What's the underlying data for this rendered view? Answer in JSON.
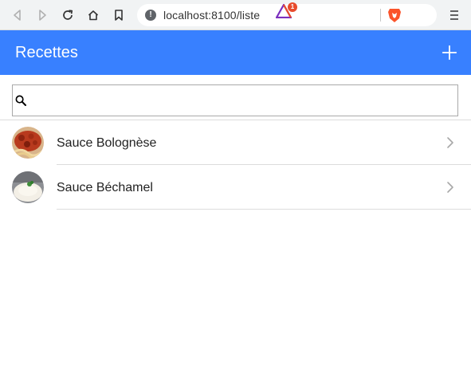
{
  "browser": {
    "url": "localhost:8100/liste",
    "rewards_badge": "1"
  },
  "header": {
    "title": "Recettes"
  },
  "search": {
    "value": "",
    "placeholder": ""
  },
  "recipes": [
    {
      "label": "Sauce Bolognèse"
    },
    {
      "label": "Sauce Béchamel"
    }
  ],
  "colors": {
    "toolbar": "#3880ff",
    "divider": "#dcdcdc"
  }
}
